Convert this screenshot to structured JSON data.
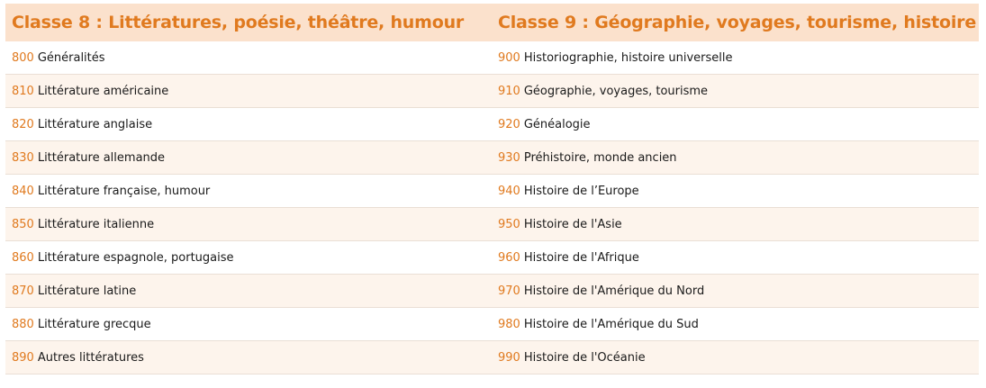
{
  "columns": [
    {
      "title": "Classe 8 : Littératures, poésie, théâtre, humour",
      "items": [
        {
          "code": "800",
          "label": "Généralités"
        },
        {
          "code": "810",
          "label": "Littérature américaine"
        },
        {
          "code": "820",
          "label": "Littérature anglaise"
        },
        {
          "code": "830",
          "label": "Littérature allemande"
        },
        {
          "code": "840",
          "label": "Littérature française, humour"
        },
        {
          "code": "850",
          "label": "Littérature italienne"
        },
        {
          "code": "860",
          "label": "Littérature espagnole, portugaise"
        },
        {
          "code": "870",
          "label": "Littérature latine"
        },
        {
          "code": "880",
          "label": "Littérature grecque"
        },
        {
          "code": "890",
          "label": "Autres littératures"
        }
      ]
    },
    {
      "title": "Classe 9 : Géographie, voyages, tourisme, histoire",
      "items": [
        {
          "code": "900",
          "label": "Historiographie, histoire universelle"
        },
        {
          "code": "910",
          "label": "Géographie, voyages, tourisme"
        },
        {
          "code": "920",
          "label": "Généalogie"
        },
        {
          "code": "930",
          "label": "Préhistoire, monde ancien"
        },
        {
          "code": "940",
          "label": "Histoire de l’Europe"
        },
        {
          "code": "950",
          "label": "Histoire de l'Asie"
        },
        {
          "code": "960",
          "label": "Histoire de l'Afrique"
        },
        {
          "code": "970",
          "label": "Histoire de l'Amérique du Nord"
        },
        {
          "code": "980",
          "label": "Histoire de l'Amérique du Sud"
        },
        {
          "code": "990",
          "label": "Histoire de l'Océanie"
        }
      ]
    }
  ],
  "colors": {
    "accent": "#e07a1f",
    "header_bg": "#fbe1cc",
    "alt_row_bg": "#fdf4ec"
  }
}
